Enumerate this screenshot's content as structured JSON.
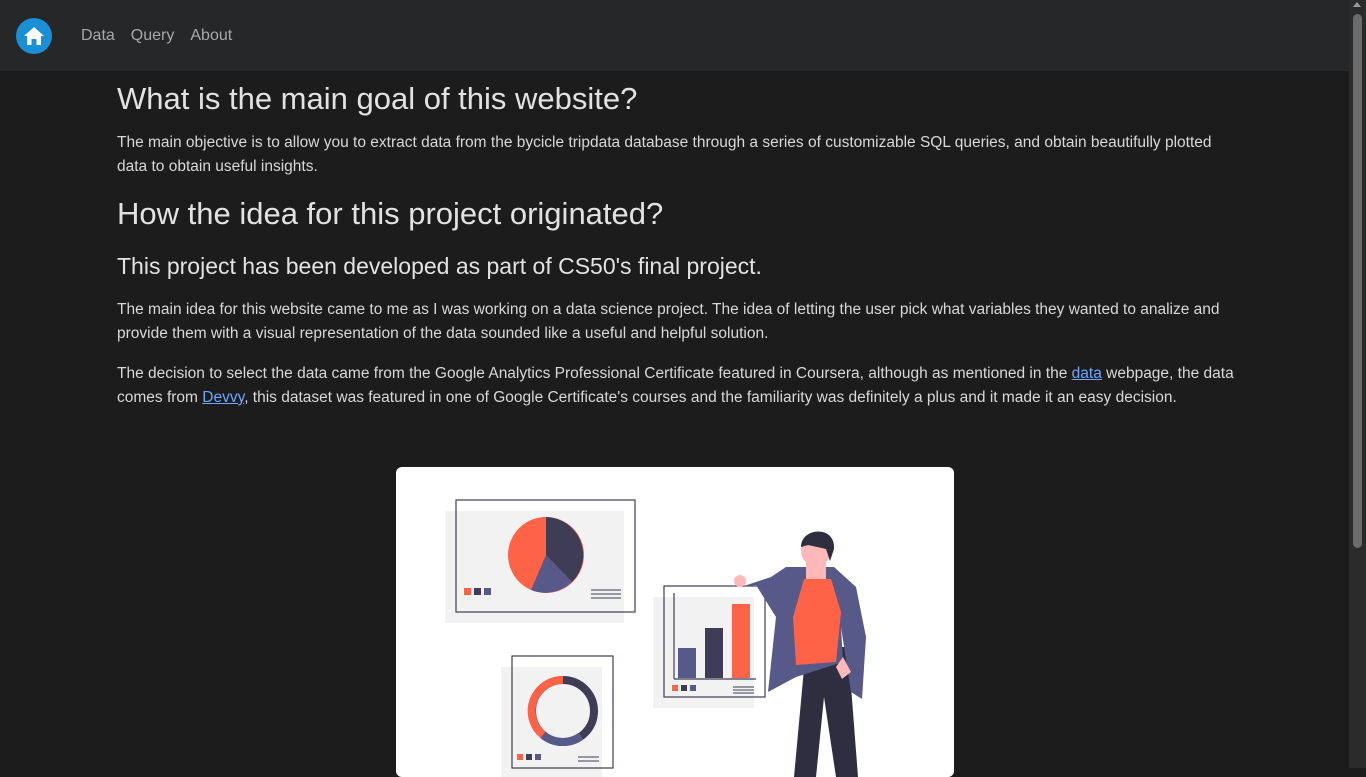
{
  "nav": {
    "home_icon": "home-icon",
    "links": [
      {
        "label": "Data"
      },
      {
        "label": "Query"
      },
      {
        "label": "About"
      }
    ]
  },
  "content": {
    "goal_heading": "What is the main goal of this website?",
    "goal_text": "The main objective is to allow you to extract data from the bycicle tripdata database through a series of customizable SQL queries, and obtain beautifully plotted data to obtain useful insights.",
    "origin_heading": "How the idea for this project originated?",
    "origin_subheading": "This project has been developed as part of CS50's final project.",
    "origin_text": "The main idea for this website came to me as I was working on a data science project. The idea of letting the user pick what variables they wanted to analize and provide them with a visual representation of the data sounded like a useful and helpful solution.",
    "decision_text_1": "The decision to select the data came from the Google Analytics Professional Certificate featured in Coursera, although as mentioned in the ",
    "decision_link_1": "data",
    "decision_text_2": " webpage, the data comes from ",
    "decision_link_2": "Devvy",
    "decision_text_3": ", this dataset was featured in one of Google Certificate's courses and the familiarity was definitely a plus and it made it an easy decision."
  },
  "colors": {
    "accent": "#1a8fd6",
    "illustration_orange": "#ff6347",
    "illustration_navy": "#3f3d56",
    "illustration_purple": "#575a89",
    "link": "#6ea8fe"
  }
}
